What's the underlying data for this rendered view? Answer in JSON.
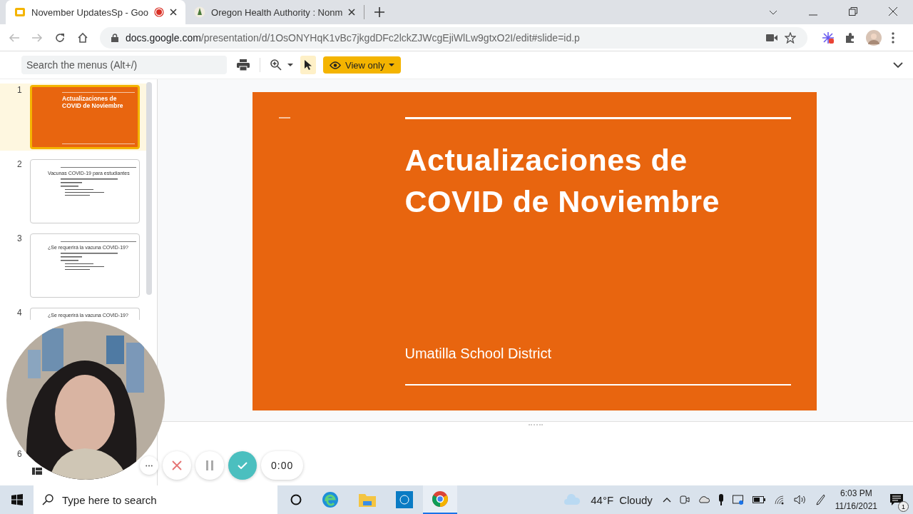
{
  "browser": {
    "tabs": [
      {
        "title": "November UpdatesSp - Goo",
        "selected": true,
        "recording": true
      },
      {
        "title": "Oregon Health Authority : Nonm",
        "selected": false,
        "recording": false
      }
    ],
    "address": {
      "host": "docs.google.com",
      "path": "/presentation/d/1OsONYHqK1vBc7jkgdDFc2lckZJWcgEjiWlLw9gtxO2I/edit#slide=id.p"
    }
  },
  "toolbar": {
    "search_placeholder": "Search the menus (Alt+/)",
    "mode_label": "View only"
  },
  "filmstrip": {
    "slides": [
      {
        "number": "1",
        "selected": true,
        "kind": "title",
        "title": "Actualizaciones de COVID de Noviembre"
      },
      {
        "number": "2",
        "selected": false,
        "kind": "content",
        "title": "Vacunas COVID-19 para estudiantes"
      },
      {
        "number": "3",
        "selected": false,
        "kind": "content",
        "title": "¿Se requerirá la vacuna COVID-19?"
      },
      {
        "number": "4",
        "selected": false,
        "kind": "content",
        "title": "¿Se requerirá la vacuna COVID-19?"
      }
    ],
    "last_number": "6"
  },
  "slide": {
    "title_lines": [
      "Actualizaciones de",
      "COVID de Noviembre"
    ],
    "subtitle": "Umatilla School District"
  },
  "recorder": {
    "time": "0:00"
  },
  "taskbar": {
    "search_placeholder": "Type here to search",
    "temperature": "44°F",
    "weather": "Cloudy",
    "time": "6:03 PM",
    "date": "11/16/2021",
    "notifications": "1"
  }
}
